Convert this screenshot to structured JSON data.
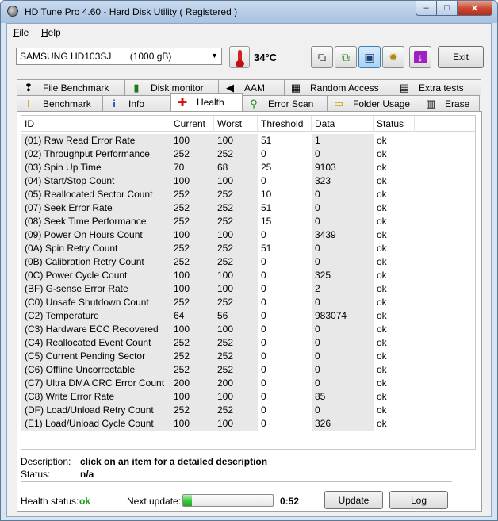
{
  "window": {
    "title": "HD Tune Pro 4.60 - Hard Disk Utility ( Registered )",
    "minimize_glyph": "–",
    "maximize_glyph": "□",
    "close_glyph": "✕"
  },
  "menu": {
    "file_key": "F",
    "file_rest": "ile",
    "help_key": "H",
    "help_rest": "elp"
  },
  "toolbar": {
    "drive": "SAMSUNG HD103SJ       (1000 gB)",
    "temperature": "34°C",
    "exit_label": "Exit",
    "icons": [
      "copy-icon",
      "copy-results-icon",
      "save-icon",
      "options-icon",
      "download-icon"
    ]
  },
  "tabs_top": [
    {
      "label": "File Benchmark",
      "icon": "file-benchmark-icon",
      "glyph": "❢"
    },
    {
      "label": "Disk monitor",
      "icon": "disk-monitor-icon",
      "glyph": "▮"
    },
    {
      "label": "AAM",
      "icon": "speaker-icon",
      "glyph": "◀"
    },
    {
      "label": "Random Access",
      "icon": "random-access-icon",
      "glyph": "▦"
    },
    {
      "label": "Extra tests",
      "icon": "extra-tests-icon",
      "glyph": "▤"
    }
  ],
  "tabs_bottom": [
    {
      "label": "Benchmark",
      "icon": "benchmark-icon",
      "glyph": "!"
    },
    {
      "label": "Info",
      "icon": "info-icon",
      "glyph": "i"
    },
    {
      "label": "Health",
      "icon": "health-cross-icon",
      "glyph": "✚"
    },
    {
      "label": "Error Scan",
      "icon": "error-scan-icon",
      "glyph": "⚲"
    },
    {
      "label": "Folder Usage",
      "icon": "folder-icon",
      "glyph": "▭"
    },
    {
      "label": "Erase",
      "icon": "erase-icon",
      "glyph": "▥"
    }
  ],
  "health": {
    "columns": [
      "ID",
      "Current",
      "Worst",
      "Threshold",
      "Data",
      "Status"
    ],
    "rows": [
      {
        "id": "(01) Raw Read Error Rate",
        "current": "100",
        "worst": "100",
        "threshold": "51",
        "data": "1",
        "status": "ok"
      },
      {
        "id": "(02) Throughput Performance",
        "current": "252",
        "worst": "252",
        "threshold": "0",
        "data": "0",
        "status": "ok"
      },
      {
        "id": "(03) Spin Up Time",
        "current": "70",
        "worst": "68",
        "threshold": "25",
        "data": "9103",
        "status": "ok"
      },
      {
        "id": "(04) Start/Stop Count",
        "current": "100",
        "worst": "100",
        "threshold": "0",
        "data": "323",
        "status": "ok"
      },
      {
        "id": "(05) Reallocated Sector Count",
        "current": "252",
        "worst": "252",
        "threshold": "10",
        "data": "0",
        "status": "ok"
      },
      {
        "id": "(07) Seek Error Rate",
        "current": "252",
        "worst": "252",
        "threshold": "51",
        "data": "0",
        "status": "ok"
      },
      {
        "id": "(08) Seek Time Performance",
        "current": "252",
        "worst": "252",
        "threshold": "15",
        "data": "0",
        "status": "ok"
      },
      {
        "id": "(09) Power On Hours Count",
        "current": "100",
        "worst": "100",
        "threshold": "0",
        "data": "3439",
        "status": "ok"
      },
      {
        "id": "(0A) Spin Retry Count",
        "current": "252",
        "worst": "252",
        "threshold": "51",
        "data": "0",
        "status": "ok"
      },
      {
        "id": "(0B) Calibration Retry Count",
        "current": "252",
        "worst": "252",
        "threshold": "0",
        "data": "0",
        "status": "ok"
      },
      {
        "id": "(0C) Power Cycle Count",
        "current": "100",
        "worst": "100",
        "threshold": "0",
        "data": "325",
        "status": "ok"
      },
      {
        "id": "(BF) G-sense Error Rate",
        "current": "100",
        "worst": "100",
        "threshold": "0",
        "data": "2",
        "status": "ok"
      },
      {
        "id": "(C0) Unsafe Shutdown Count",
        "current": "252",
        "worst": "252",
        "threshold": "0",
        "data": "0",
        "status": "ok"
      },
      {
        "id": "(C2) Temperature",
        "current": "64",
        "worst": "56",
        "threshold": "0",
        "data": "983074",
        "status": "ok"
      },
      {
        "id": "(C3) Hardware ECC Recovered",
        "current": "100",
        "worst": "100",
        "threshold": "0",
        "data": "0",
        "status": "ok"
      },
      {
        "id": "(C4) Reallocated Event Count",
        "current": "252",
        "worst": "252",
        "threshold": "0",
        "data": "0",
        "status": "ok"
      },
      {
        "id": "(C5) Current Pending Sector",
        "current": "252",
        "worst": "252",
        "threshold": "0",
        "data": "0",
        "status": "ok"
      },
      {
        "id": "(C6) Offline Uncorrectable",
        "current": "252",
        "worst": "252",
        "threshold": "0",
        "data": "0",
        "status": "ok"
      },
      {
        "id": "(C7) Ultra DMA CRC Error Count",
        "current": "200",
        "worst": "200",
        "threshold": "0",
        "data": "0",
        "status": "ok"
      },
      {
        "id": "(C8) Write Error Rate",
        "current": "100",
        "worst": "100",
        "threshold": "0",
        "data": "85",
        "status": "ok"
      },
      {
        "id": "(DF) Load/Unload Retry Count",
        "current": "252",
        "worst": "252",
        "threshold": "0",
        "data": "0",
        "status": "ok"
      },
      {
        "id": "(E1) Load/Unload Cycle Count",
        "current": "100",
        "worst": "100",
        "threshold": "0",
        "data": "326",
        "status": "ok"
      }
    ]
  },
  "details": {
    "description_label": "Description:",
    "description_value": "click on an item for a detailed description",
    "status_label": "Status:",
    "status_value": "n/a"
  },
  "footer": {
    "health_label": "Health status:",
    "health_value": "ok",
    "health_color": "#1c9e1c",
    "next_update_label": "Next update:",
    "progress_fraction": 0.1,
    "countdown": "0:52",
    "update_label": "Update",
    "log_label": "Log"
  }
}
